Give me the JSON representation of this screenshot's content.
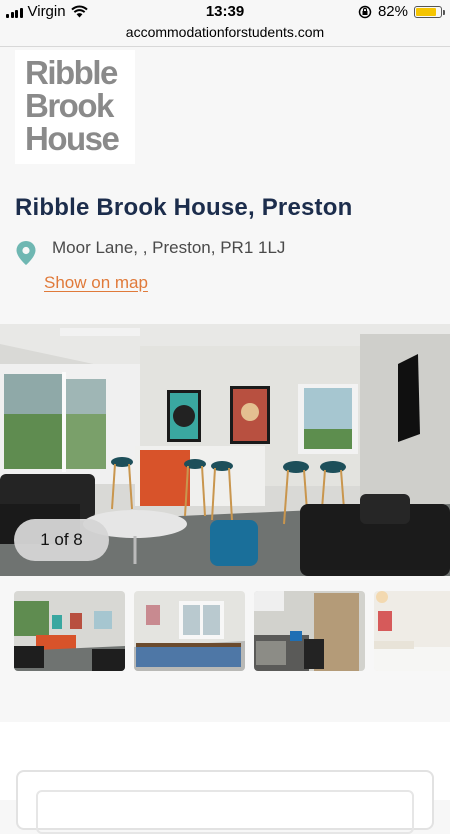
{
  "status_bar": {
    "carrier": "Virgin",
    "time": "13:39",
    "battery_percent": "82%",
    "battery_level": 0.82,
    "icons": [
      "signal-icon",
      "wifi-icon",
      "rotation-lock-icon",
      "battery-icon"
    ]
  },
  "browser": {
    "url": "accommodationforstudents.com"
  },
  "logo": {
    "lines": [
      "Ribble",
      "Brook",
      "House"
    ]
  },
  "property": {
    "title": "Ribble Brook House, Preston",
    "address": "Moor Lane, , Preston, PR1 1LJ",
    "map_link": "Show on map"
  },
  "gallery": {
    "counter": "1 of 8",
    "thumbnails": [
      "common-room",
      "pool-table-room",
      "study-bedroom",
      "bedroom"
    ]
  },
  "colors": {
    "title": "#1c2d4c",
    "link": "#e07a3a",
    "pin": "#6fb7b2",
    "battery": "#f5c400"
  }
}
